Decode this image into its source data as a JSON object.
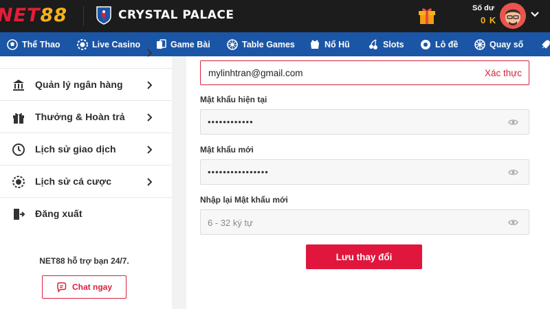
{
  "header": {
    "brand_main": "NET",
    "brand_accent": "88",
    "partner": "CRYSTAL PALACE",
    "balance_label": "Số dư",
    "balance_value": "0 K"
  },
  "nav": {
    "items": [
      {
        "label": "Thể Thao",
        "icon": "soccer-ball-icon"
      },
      {
        "label": "Live Casino",
        "icon": "poker-chip-icon"
      },
      {
        "label": "Game Bài",
        "icon": "playing-cards-icon"
      },
      {
        "label": "Table Games",
        "icon": "roulette-icon"
      },
      {
        "label": "Nổ Hũ",
        "icon": "slot-icon"
      },
      {
        "label": "Slots",
        "icon": "cherry-icon"
      },
      {
        "label": "Lô đề",
        "icon": "lottery-ball-icon"
      },
      {
        "label": "Quay số",
        "icon": "wheel-icon"
      }
    ]
  },
  "sidebar": {
    "items": [
      {
        "label": "Quản lý ngân hàng",
        "icon": "bank-icon"
      },
      {
        "label": "Thưởng & Hoàn trả",
        "icon": "gift-icon"
      },
      {
        "label": "Lịch sử giao dịch",
        "icon": "history-icon"
      },
      {
        "label": "Lịch sử cá cược",
        "icon": "bet-history-icon"
      },
      {
        "label": "Đăng xuất",
        "icon": "logout-icon"
      }
    ],
    "support_text": "NET88 hỗ trợ bạn 24/7.",
    "chat_label": "Chat ngay"
  },
  "form": {
    "email": "mylinhtran@gmail.com",
    "verify_label": "Xác thực",
    "current_pw_label": "Mật khẩu hiện tại",
    "current_pw_value": "••••••••••••",
    "new_pw_label": "Mật khẩu mới",
    "new_pw_value": "••••••••••••••••",
    "confirm_pw_label": "Nhập lại Mật khẩu mới",
    "confirm_pw_placeholder": "6 - 32 ký tự",
    "save_label": "Lưu thay đổi"
  },
  "colors": {
    "header_bg": "#1c1c1c",
    "nav_bg": "#1b56a6",
    "accent_red": "#e1163d",
    "brand_yellow": "#f6b218"
  }
}
